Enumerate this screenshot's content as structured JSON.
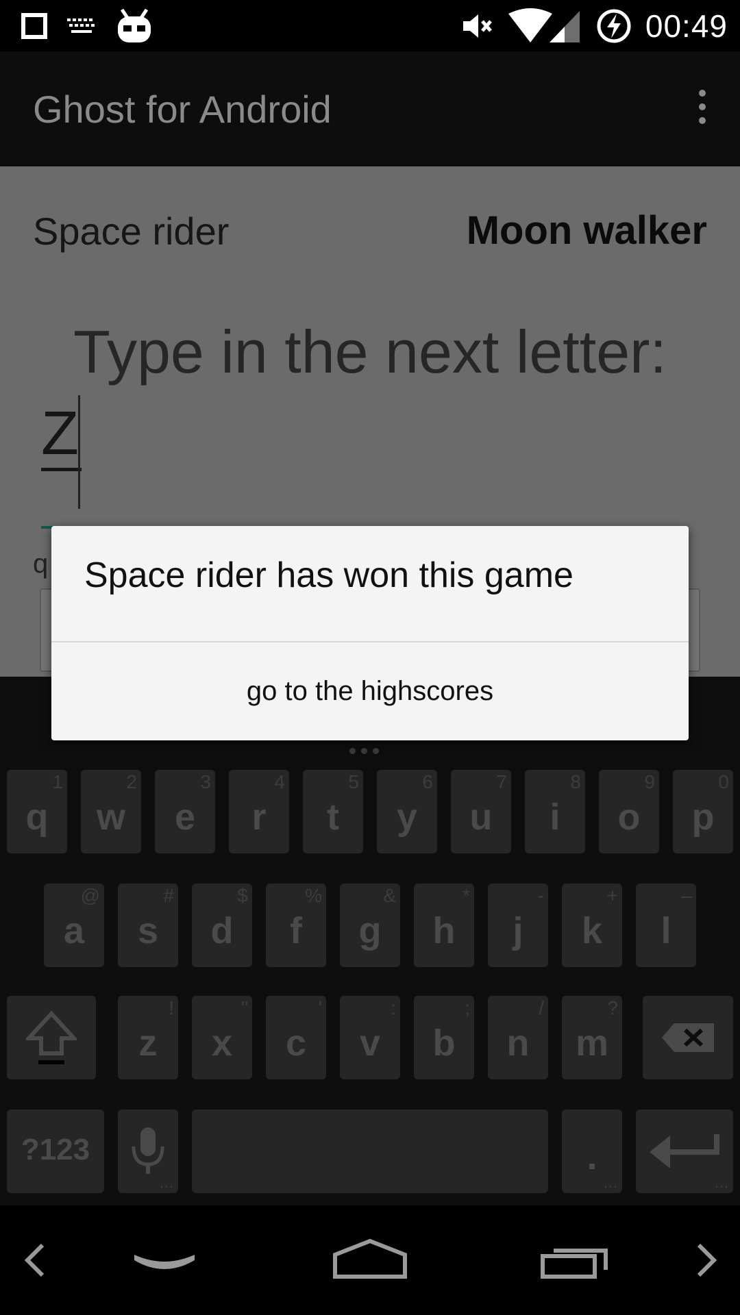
{
  "status_bar": {
    "time": "00:49",
    "icons": [
      "square-icon",
      "keyboard-icon",
      "cyanogen-bot-icon",
      "mute-icon",
      "wifi-icon",
      "signal-icon",
      "battery-charging-icon"
    ]
  },
  "app_bar": {
    "title": "Ghost for Android",
    "menu_icon": "overflow-menu-icon"
  },
  "game": {
    "player_left": "Space rider",
    "player_right": "Moon walker",
    "prompt": "Type in the next letter:",
    "input_value": "Z",
    "hint_fragment": "q"
  },
  "dialog": {
    "message": "Space rider has won this game",
    "button_label": "go to the highscores"
  },
  "keyboard": {
    "row1": [
      {
        "key": "q",
        "hint": "1"
      },
      {
        "key": "w",
        "hint": "2"
      },
      {
        "key": "e",
        "hint": "3"
      },
      {
        "key": "r",
        "hint": "4"
      },
      {
        "key": "t",
        "hint": "5"
      },
      {
        "key": "y",
        "hint": "6"
      },
      {
        "key": "u",
        "hint": "7"
      },
      {
        "key": "i",
        "hint": "8"
      },
      {
        "key": "o",
        "hint": "9"
      },
      {
        "key": "p",
        "hint": "0"
      }
    ],
    "row2": [
      {
        "key": "a",
        "hint": "@"
      },
      {
        "key": "s",
        "hint": "#"
      },
      {
        "key": "d",
        "hint": "$"
      },
      {
        "key": "f",
        "hint": "%"
      },
      {
        "key": "g",
        "hint": "&"
      },
      {
        "key": "h",
        "hint": "*"
      },
      {
        "key": "j",
        "hint": "-"
      },
      {
        "key": "k",
        "hint": "+"
      },
      {
        "key": "l",
        "hint": "–"
      }
    ],
    "row3": [
      {
        "key": "z",
        "hint": "!"
      },
      {
        "key": "x",
        "hint": "\""
      },
      {
        "key": "c",
        "hint": "'"
      },
      {
        "key": "v",
        "hint": ":"
      },
      {
        "key": "b",
        "hint": ";"
      },
      {
        "key": "n",
        "hint": "/"
      },
      {
        "key": "m",
        "hint": "?"
      }
    ],
    "symbols_label": "?123",
    "period_label": ".",
    "more_glyph": "…"
  },
  "nav_bar": {
    "icons": [
      "back-arrow-icon",
      "hide-keyboard-icon",
      "home-icon",
      "recents-icon",
      "forward-arrow-icon"
    ]
  }
}
